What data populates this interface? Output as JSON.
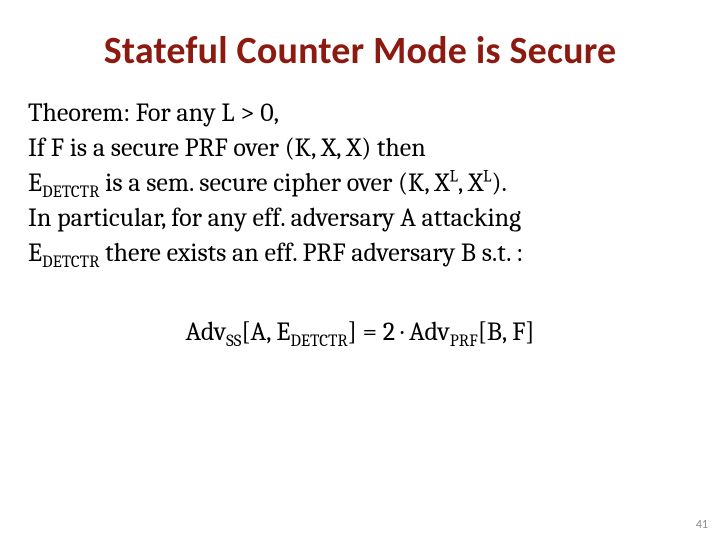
{
  "title": "Stateful Counter Mode is Secure",
  "body": {
    "line1_a": "Theorem: For any L > 0,",
    "line2_a": "If F is a secure PRF over (K, X, X) then",
    "line3_a": "E",
    "line3_sub": "DETCTR",
    "line3_b": " is a sem. secure cipher over (K, X",
    "line3_sup1": "L",
    "line3_c": ", X",
    "line3_sup2": "L",
    "line3_d": ").",
    "line4_a": "In particular, for any eff. adversary A attacking",
    "line5_a": "E",
    "line5_sub": "DETCTR",
    "line5_b": " there exists an eff. PRF adversary B s.t. :"
  },
  "adv": {
    "a": "Adv",
    "sub1": "SS",
    "b": "[A, E",
    "sub2": "DETCTR",
    "c": "] = 2 · Adv",
    "sub3": "PRF",
    "d": "[B, F]"
  },
  "page_number": "41"
}
